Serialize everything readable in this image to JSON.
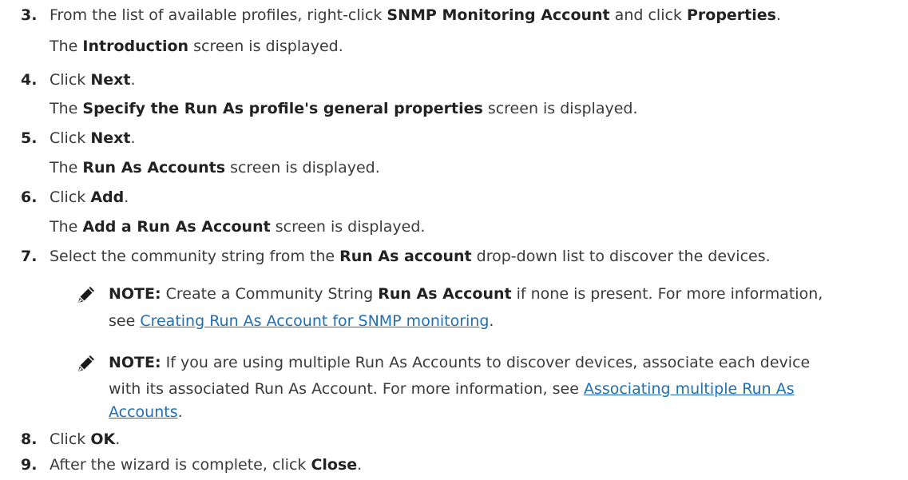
{
  "steps": [
    {
      "number": "3.",
      "parts": [
        "From the list of available profiles, right-click ",
        "SNMP Monitoring Account",
        " and click ",
        "Properties",
        "."
      ],
      "result": [
        "The ",
        "Introduction",
        " screen is displayed."
      ]
    },
    {
      "number": "4.",
      "parts": [
        "Click ",
        "Next",
        "."
      ],
      "result": [
        "The ",
        "Specify the Run As profile's general properties",
        " screen is displayed."
      ]
    },
    {
      "number": "5.",
      "parts": [
        "Click ",
        "Next",
        "."
      ],
      "result": [
        "The ",
        "Run As Accounts",
        " screen is displayed."
      ]
    },
    {
      "number": "6.",
      "parts": [
        "Click ",
        "Add",
        "."
      ],
      "result": [
        "The ",
        "Add a Run As Account",
        " screen is displayed."
      ]
    },
    {
      "number": "7.",
      "parts": [
        "Select the community string from the ",
        "Run As account",
        " drop-down list to discover the devices."
      ]
    },
    {
      "number": "8.",
      "parts": [
        "Click ",
        "OK",
        "."
      ]
    },
    {
      "number": "9.",
      "parts": [
        "After the wizard is complete, click ",
        "Close",
        "."
      ]
    }
  ],
  "notes": [
    {
      "label": "NOTE:",
      "line1": [
        " Create a Community String ",
        "Run As Account",
        " if none is present. For more information,"
      ],
      "line2_pre": "see ",
      "line2_link": "Creating Run As Account for SNMP monitoring",
      "line2_post": "."
    },
    {
      "label": "NOTE:",
      "line1": [
        " If you are using multiple Run As Accounts to discover devices, associate each device"
      ],
      "line2_pre": "with its associated Run As Account. For more information, see ",
      "line2_link": "Associating multiple Run As",
      "line3_link": "Accounts",
      "line3_post": "."
    }
  ],
  "icons": {
    "note": "pencil-note-icon"
  }
}
